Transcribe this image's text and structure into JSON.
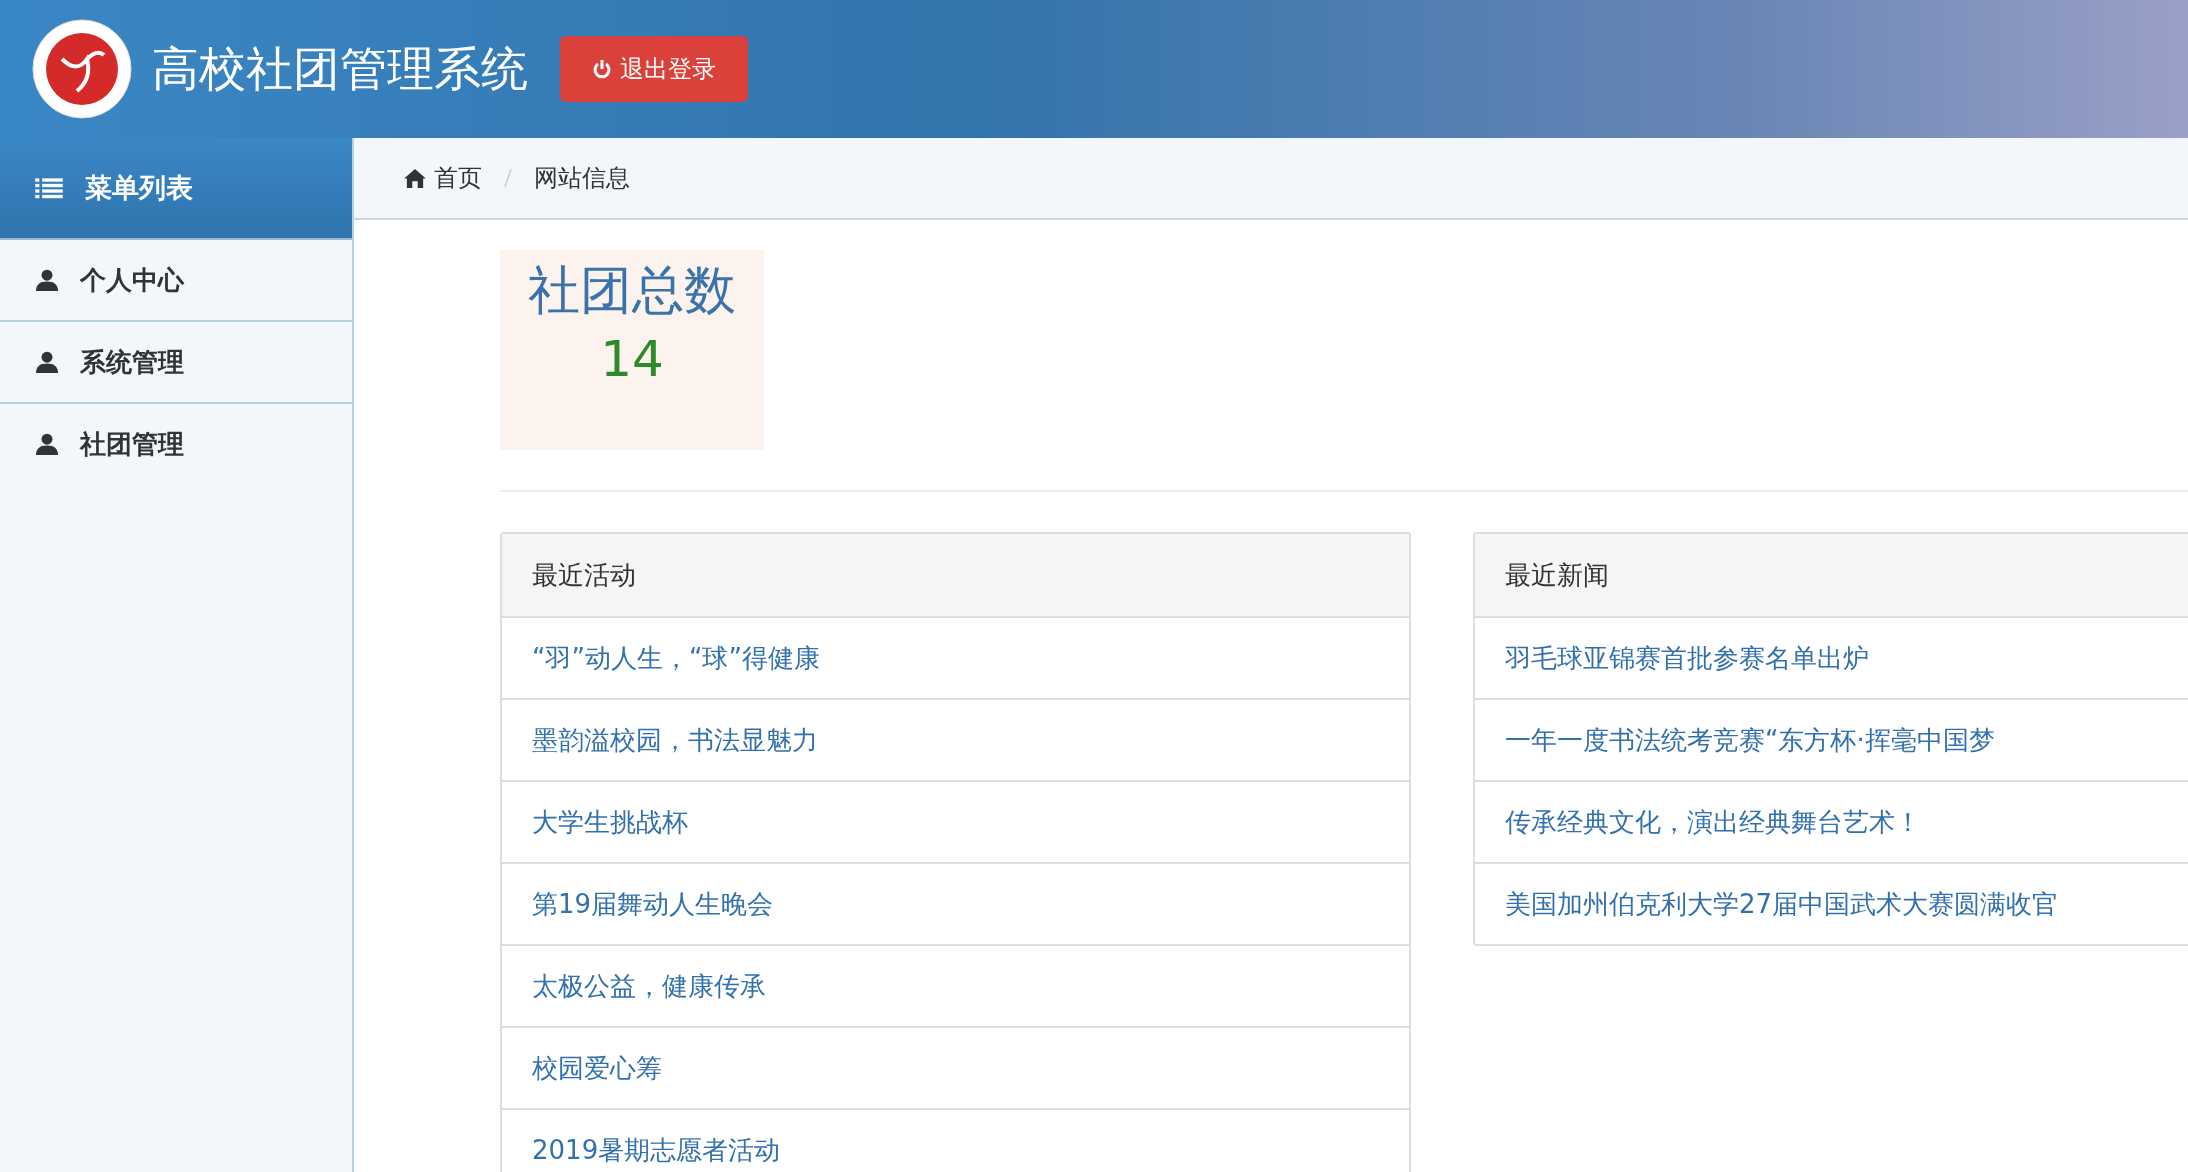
{
  "header": {
    "title": "高校社团管理系统",
    "logout_button": "退出登录"
  },
  "sidebar": {
    "heading": "菜单列表",
    "items": [
      {
        "label": "个人中心"
      },
      {
        "label": "系统管理"
      },
      {
        "label": "社团管理"
      }
    ]
  },
  "breadcrumb": [
    "首页",
    "网站信息"
  ],
  "stat": {
    "label": "社团总数",
    "value": "14"
  },
  "panels": [
    {
      "title": "最近活动",
      "items": [
        "“羽”动人生，“球”得健康",
        "墨韵溢校园，书法显魅力",
        "大学生挑战杯",
        "第19届舞动人生晚会",
        "太极公益，健康传承",
        "校园爱心筹",
        "2019暑期志愿者活动"
      ]
    },
    {
      "title": "最近新闻",
      "items": [
        "羽毛球亚锦赛首批参赛名单出炉",
        "一年一度书法统考竞赛“东方杯·挥毫中国梦",
        "传承经典文化，演出经典舞台艺术！",
        "美国加州伯克利大学27届中国武术大赛圆满收官"
      ]
    }
  ]
}
